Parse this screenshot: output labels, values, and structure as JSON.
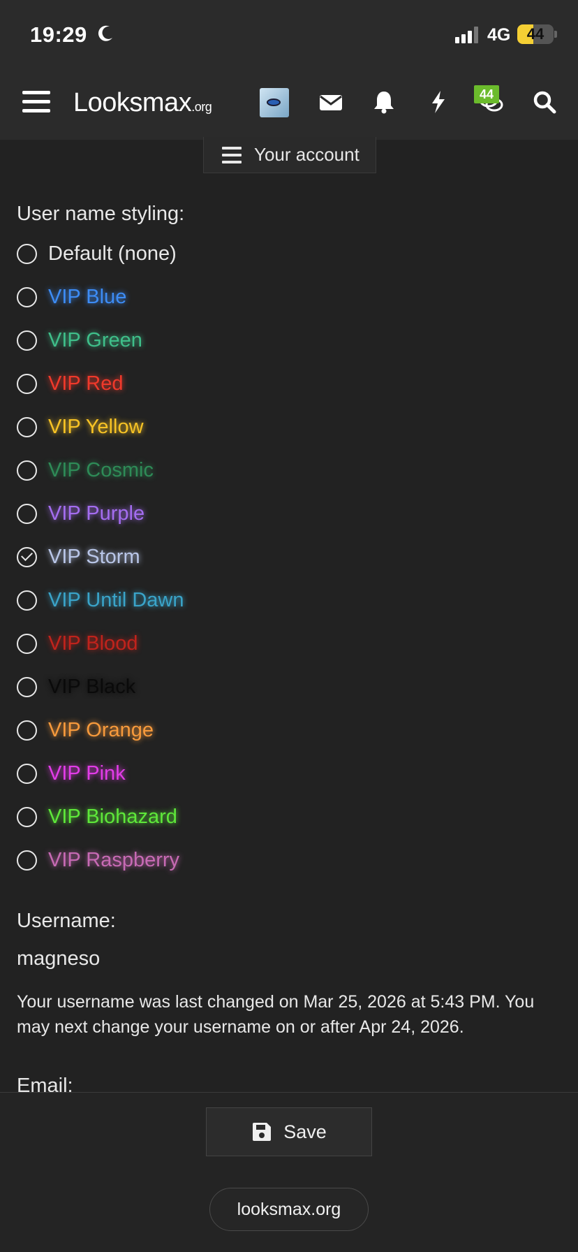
{
  "status_bar": {
    "time": "19:29",
    "network": "4G",
    "battery": "44",
    "battery_level": 0.44
  },
  "header": {
    "logo_main": "Looksmax",
    "logo_suffix": ".org",
    "chat_badge": "44",
    "icons": [
      "menu-icon",
      "avatar",
      "mail-icon",
      "bell-icon",
      "bolt-icon",
      "chat-icon",
      "search-icon"
    ]
  },
  "account_tab": {
    "label": "Your account"
  },
  "styling": {
    "label": "User name styling:",
    "options": [
      {
        "label": "Default (none)",
        "color": "#e8e8e8",
        "checked": false
      },
      {
        "label": "VIP Blue",
        "color": "#3d8cf5",
        "checked": false
      },
      {
        "label": "VIP Green",
        "color": "#3fbf8a",
        "checked": false
      },
      {
        "label": "VIP Red",
        "color": "#f0392b",
        "checked": false
      },
      {
        "label": "VIP Yellow",
        "color": "#f7c325",
        "checked": false
      },
      {
        "label": "VIP Cosmic",
        "color": "#2e8b57",
        "checked": false
      },
      {
        "label": "VIP Purple",
        "color": "#a46df0",
        "checked": false
      },
      {
        "label": "VIP Storm",
        "color": "#b9c6e8",
        "checked": true
      },
      {
        "label": "VIP Until Dawn",
        "color": "#3aa4c9",
        "checked": false
      },
      {
        "label": "VIP Blood",
        "color": "#c0231c",
        "checked": false
      },
      {
        "label": "VIP Black",
        "color": "#0a0a0a",
        "checked": false
      },
      {
        "label": "VIP Orange",
        "color": "#f79a3c",
        "checked": false
      },
      {
        "label": "VIP Pink",
        "color": "#e23ce8",
        "checked": false
      },
      {
        "label": "VIP Biohazard",
        "color": "#5ee83a",
        "checked": false
      },
      {
        "label": "VIP Raspberry",
        "color": "#c76ab4",
        "checked": false
      }
    ]
  },
  "username": {
    "label": "Username:",
    "value": "magneso",
    "note": "Your username was last changed on Mar 25, 2026 at 5:43 PM. You may next change your username on or after Apr 24, 2026."
  },
  "email": {
    "label": "Email:"
  },
  "save_label": "Save",
  "site_label": "looksmax.org"
}
